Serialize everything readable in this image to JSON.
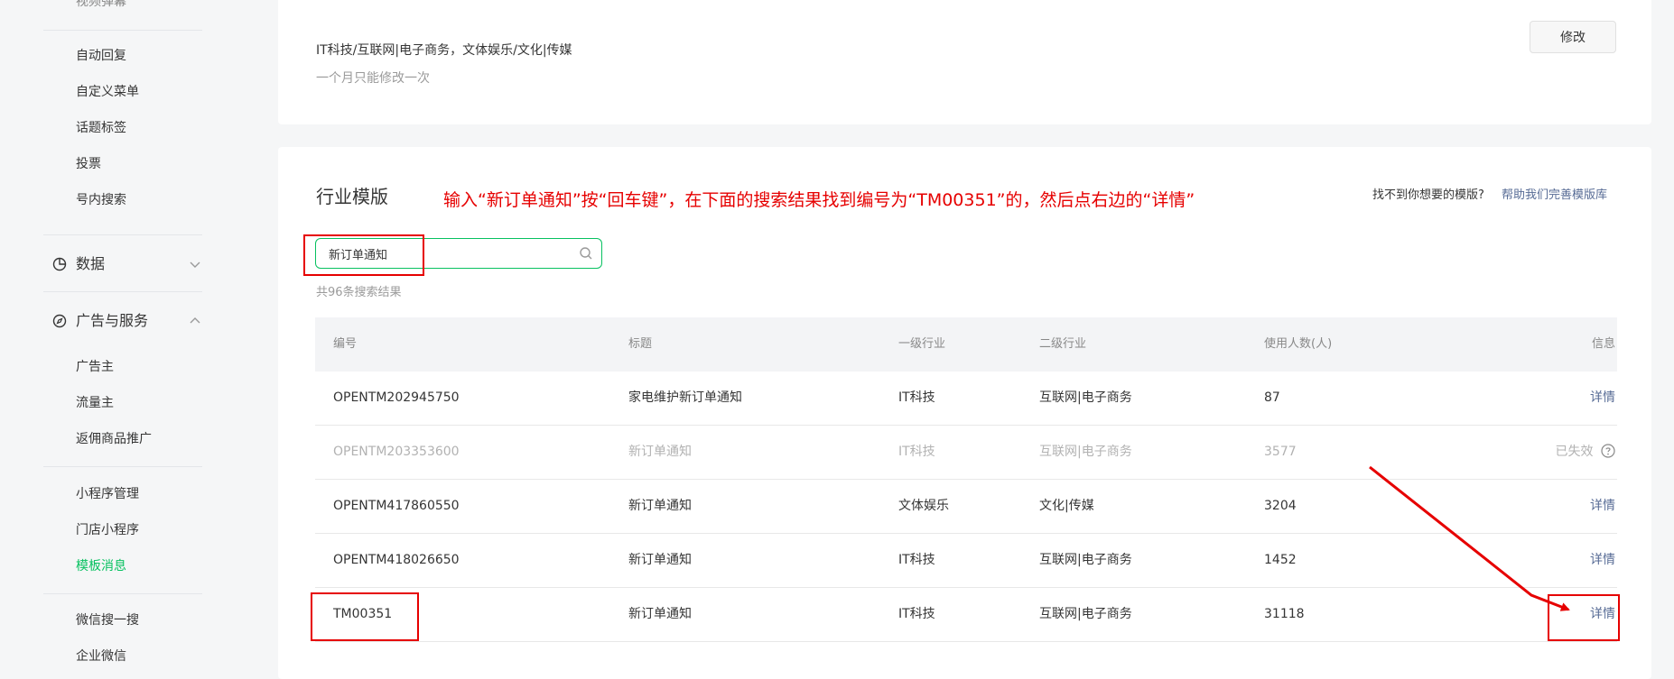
{
  "sidebar": {
    "cut_item": "视频弹幕",
    "items_top": [
      {
        "label": "自动回复"
      },
      {
        "label": "自定义菜单"
      },
      {
        "label": "话题标签"
      },
      {
        "label": "投票"
      },
      {
        "label": "号内搜索"
      }
    ],
    "group_data": {
      "label": "数据",
      "icon": "pie-chart-icon"
    },
    "group_ads": {
      "label": "广告与服务",
      "icon": "compass-icon"
    },
    "ads_items": [
      {
        "label": "广告主"
      },
      {
        "label": "流量主"
      },
      {
        "label": "返佣商品推广"
      }
    ],
    "mini_items": [
      {
        "label": "小程序管理"
      },
      {
        "label": "门店小程序"
      },
      {
        "label": "模板消息",
        "active": true
      }
    ],
    "bottom_items": [
      {
        "label": "微信搜一搜"
      },
      {
        "label": "企业微信"
      }
    ]
  },
  "industry": {
    "value": "IT科技/互联网|电子商务，文体娱乐/文化|传媒",
    "note": "一个月只能修改一次",
    "modify_label": "修改"
  },
  "templates": {
    "title": "行业模版",
    "instruction": "输入“新订单通知”按“回车键”，在下面的搜索结果找到编号为“TM00351”的，然后点右边的“详情”",
    "help_text": "找不到你想要的模版?",
    "help_link": "帮助我们完善模版库",
    "search_value": "新订单通知",
    "result_count": "共96条搜索结果",
    "columns": [
      "编号",
      "标题",
      "一级行业",
      "二级行业",
      "使用人数(人)",
      "信息"
    ],
    "rows": [
      {
        "id": "OPENTM202945750",
        "title": "家电维护新订单通知",
        "level1": "IT科技",
        "level2": "互联网|电子商务",
        "users": "87",
        "info": "详情"
      },
      {
        "id": "OPENTM203353600",
        "title": "新订单通知",
        "level1": "IT科技",
        "level2": "互联网|电子商务",
        "users": "3577",
        "info": "已失效"
      },
      {
        "id": "OPENTM417860550",
        "title": "新订单通知",
        "level1": "文体娱乐",
        "level2": "文化|传媒",
        "users": "3204",
        "info": "详情"
      },
      {
        "id": "OPENTM418026650",
        "title": "新订单通知",
        "level1": "IT科技",
        "level2": "互联网|电子商务",
        "users": "1452",
        "info": "详情"
      },
      {
        "id": "TM00351",
        "title": "新订单通知",
        "level1": "IT科技",
        "level2": "互联网|电子商务",
        "users": "31118",
        "info": "详情"
      }
    ]
  },
  "colors": {
    "accent": "#07c160",
    "link": "#576b95",
    "annotation": "#e60000"
  }
}
